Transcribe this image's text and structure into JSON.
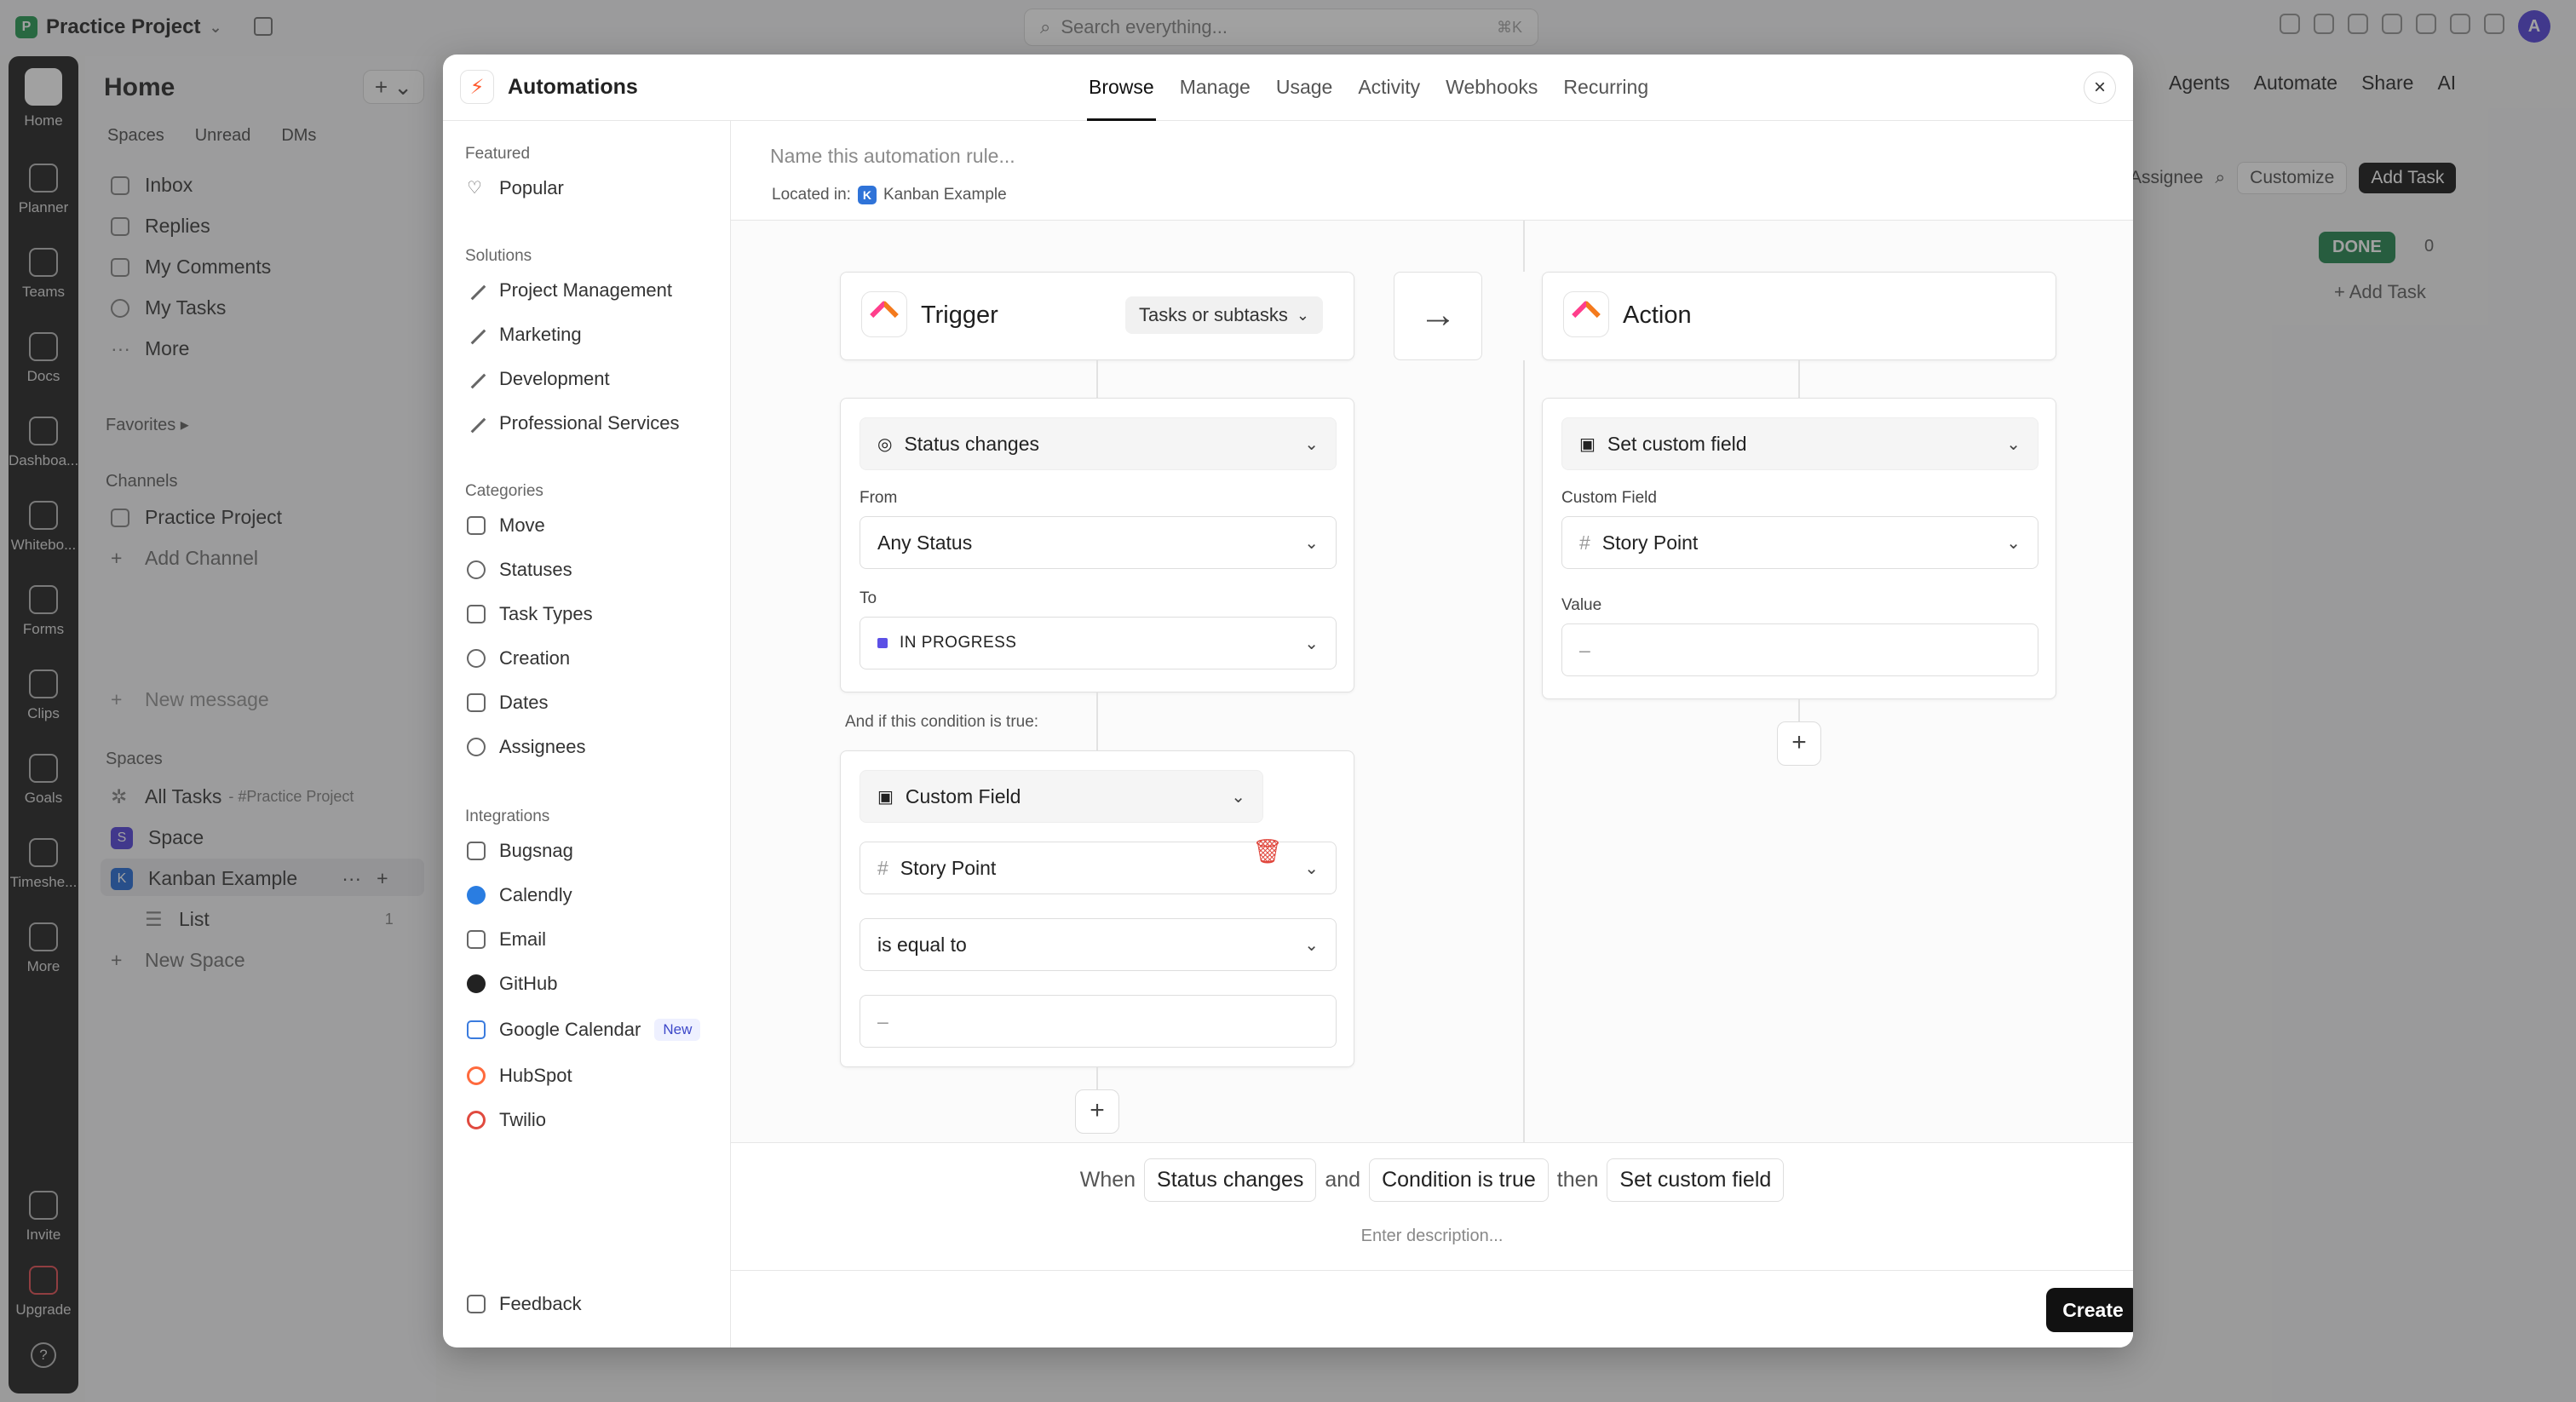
{
  "app": {
    "workspace_initial": "P",
    "workspace_name": "Practice Project",
    "search_placeholder": "Search everything...",
    "search_shortcut": "⌘K",
    "user_initial": "A"
  },
  "rail": {
    "items": [
      "Home",
      "Planner",
      "Teams",
      "Docs",
      "Dashboa...",
      "Whitebo...",
      "Forms",
      "Clips",
      "Goals",
      "Timeshe...",
      "More"
    ],
    "invite": "Invite",
    "upgrade": "Upgrade",
    "help": "?"
  },
  "sidebar": {
    "title": "Home",
    "tabs": [
      "Spaces",
      "Unread",
      "DMs"
    ],
    "nav": [
      "Inbox",
      "Replies",
      "My Comments",
      "My Tasks",
      "More"
    ],
    "favorites": "Favorites",
    "channels_title": "Channels",
    "channel": "Practice Project",
    "add_channel": "Add Channel",
    "new_message": "New message",
    "spaces_title": "Spaces",
    "all_tasks": "All Tasks",
    "all_tasks_sub": "- #Practice Project",
    "space_initial": "S",
    "space": "Space",
    "kanban_initial": "K",
    "kanban": "Kanban Example",
    "list": "List",
    "list_count": "1",
    "new_space": "New Space"
  },
  "background": {
    "top_actions": [
      "Agents",
      "Automate",
      "Share",
      "AI"
    ],
    "assignee": "Assignee",
    "customize": "Customize",
    "add_task": "Add Task",
    "done": "DONE",
    "done_count": "0",
    "add_task_column": "+ Add Task"
  },
  "modal": {
    "title": "Automations",
    "tabs": [
      "Browse",
      "Manage",
      "Usage",
      "Activity",
      "Webhooks",
      "Recurring"
    ],
    "active_tab": "Browse",
    "close": "×"
  },
  "nav": {
    "featured": "Featured",
    "popular": "Popular",
    "solutions": "Solutions",
    "solution_items": [
      "Project Management",
      "Marketing",
      "Development",
      "Professional Services"
    ],
    "categories": "Categories",
    "category_items": [
      "Move",
      "Statuses",
      "Task Types",
      "Creation",
      "Dates",
      "Assignees"
    ],
    "integrations": "Integrations",
    "integration_items": [
      "Bugsnag",
      "Calendly",
      "Email",
      "GitHub",
      "Google Calendar",
      "HubSpot",
      "Twilio"
    ],
    "new_badge": "New",
    "feedback": "Feedback"
  },
  "rule": {
    "name_placeholder": "Name this automation rule...",
    "located_label": "Located in:",
    "located_initial": "K",
    "located_value": "Kanban Example"
  },
  "trigger": {
    "title": "Trigger",
    "scope": "Tasks or subtasks",
    "event": "Status changes",
    "from_label": "From",
    "from_value": "Any Status",
    "to_label": "To",
    "to_value": "IN PROGRESS",
    "to_color": "#5c50e6"
  },
  "condition": {
    "label": "And if this condition is true:",
    "type": "Custom Field",
    "field": "Story Point",
    "operator": "is equal to",
    "value": "–"
  },
  "action": {
    "title": "Action",
    "type": "Set custom field",
    "field_label": "Custom Field",
    "field_value": "Story Point",
    "value_label": "Value",
    "value": "–"
  },
  "summary": {
    "when": "When",
    "trigger_chip": "Status changes",
    "and": "and",
    "condition_chip": "Condition is true",
    "then": "then",
    "action_chip": "Set custom field",
    "description_placeholder": "Enter description..."
  },
  "footer": {
    "create": "Create"
  }
}
